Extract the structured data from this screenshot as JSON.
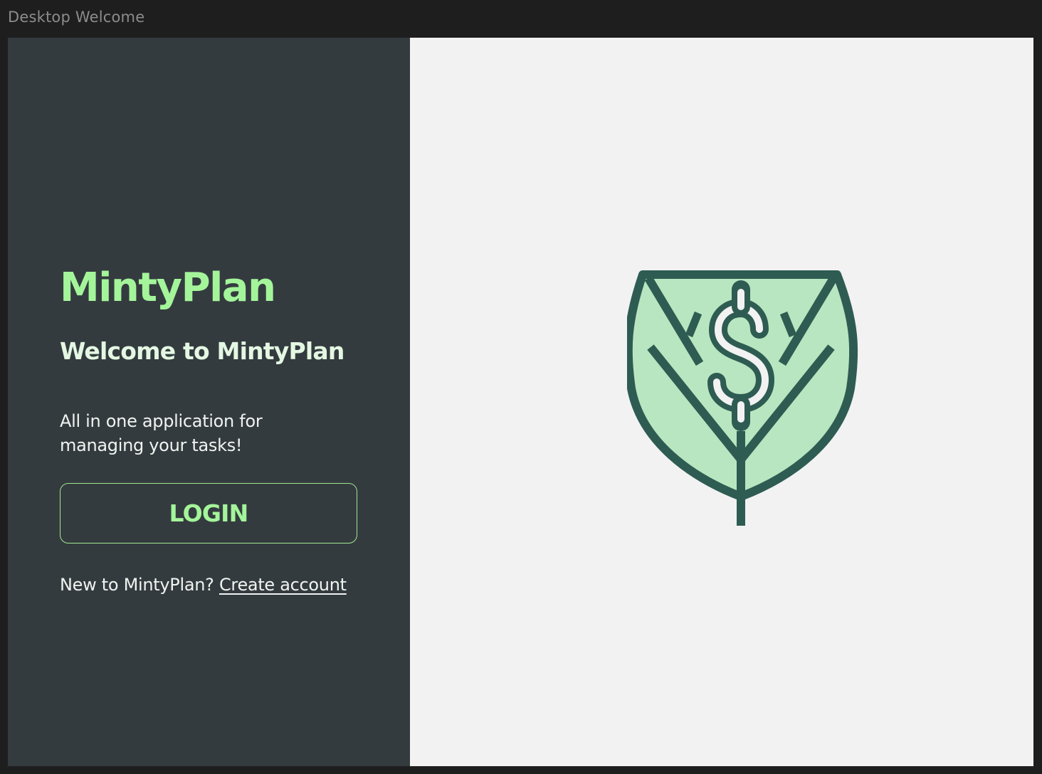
{
  "frame": {
    "title": "Desktop Welcome"
  },
  "left_panel": {
    "brand": "MintyPlan",
    "welcome": "Welcome to MintyPlan",
    "tagline": "All in one application for managing your tasks!",
    "login_label": "LOGIN",
    "signup_prompt": "New to MintyPlan?",
    "signup_link": "Create account"
  },
  "right_panel": {
    "illustration_icon": "leaf-dollar-icon"
  },
  "colors": {
    "panel_dark": "#343b3f",
    "panel_light": "#f2f2f2",
    "accent_green": "#a4f59a",
    "leaf_fill": "#b8e6c0",
    "leaf_stroke": "#2e5c52"
  }
}
